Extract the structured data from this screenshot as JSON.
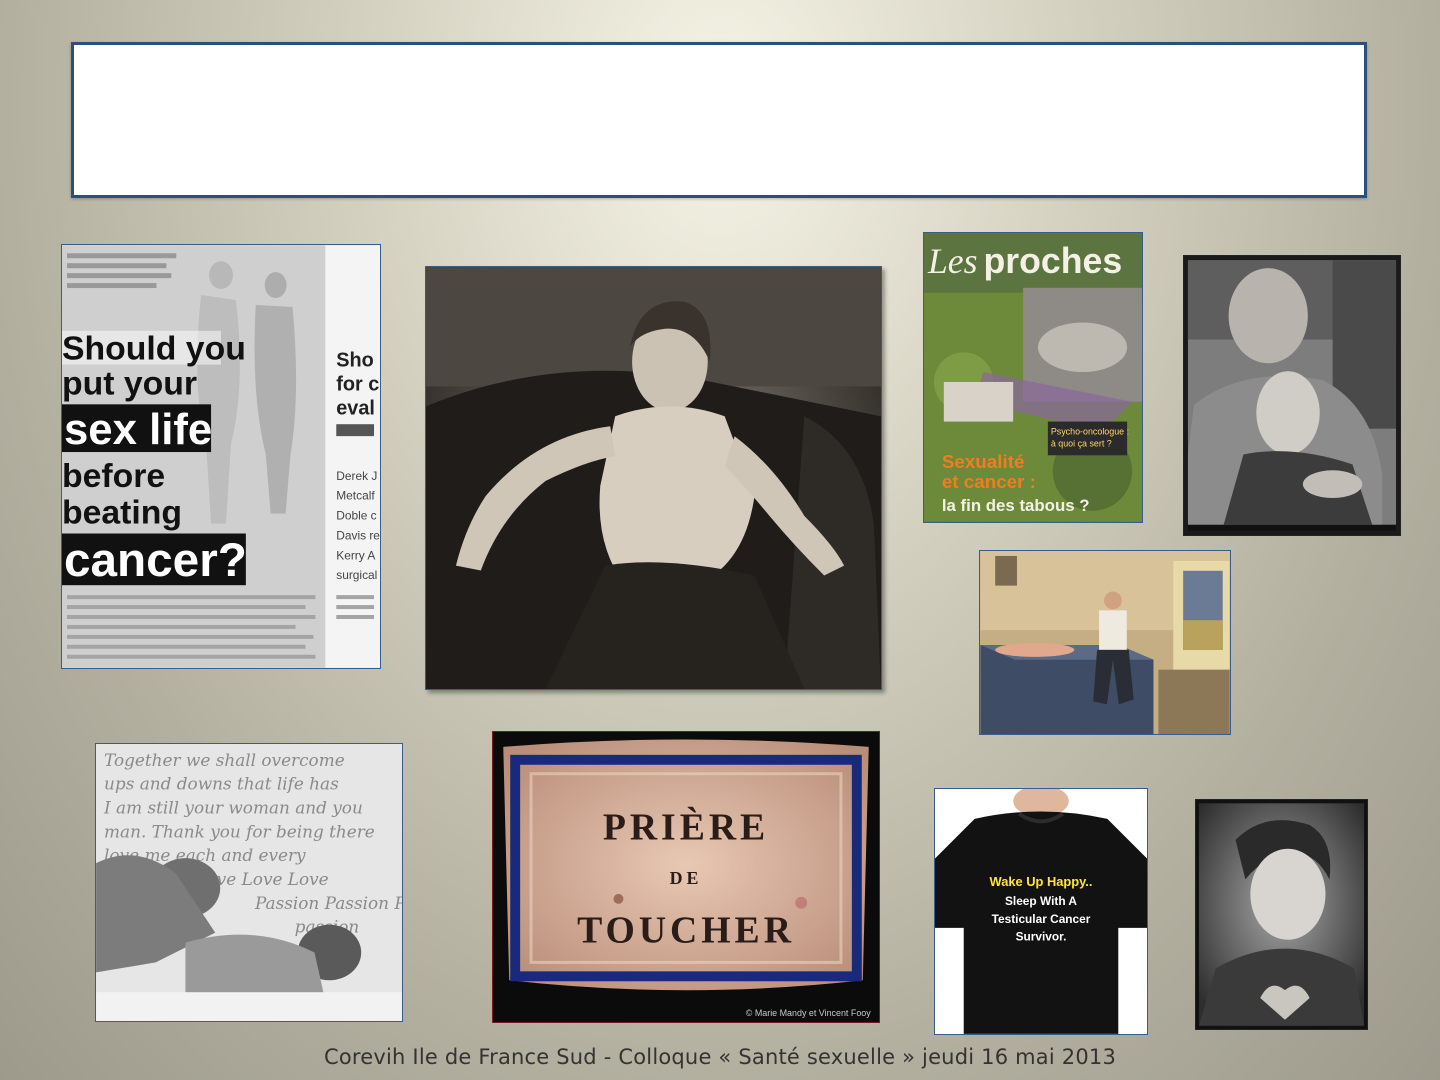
{
  "slide": {
    "footer": "Corevih Ile de France Sud - Colloque « Santé sexuelle » jeudi 16 mai 2013"
  },
  "images": {
    "newspaper": {
      "headline": [
        "Should you",
        "put your",
        "sex life",
        "before",
        "beating",
        "cancer?"
      ],
      "side_text": [
        "Sho",
        "for c",
        "eval"
      ],
      "names": [
        "Derek J",
        "Metcalf",
        "Doble c",
        "Davis re",
        "Kerry A",
        "surgical"
      ]
    },
    "magazine": {
      "title_les": "Les",
      "title_proches": "proches",
      "headline": [
        "Sexualité",
        "et cancer :",
        "la fin des tabous ?"
      ],
      "side_box": [
        "Psycho-oncologue :",
        "à quoi ça sert ?"
      ]
    },
    "priere": {
      "lines": [
        "PRIÈRE",
        "DE",
        "TOUCHER"
      ],
      "credit": "© Marie Mandy et Vincent Fooy"
    },
    "tshirt": {
      "lines": [
        "Wake Up Happy..",
        "Sleep With A",
        "Testicular Cancer",
        "Survivor."
      ]
    },
    "handwritten": {
      "lines": [
        "Together we shall overcome",
        "ups and downs that life has",
        "I am still your woman and you",
        "man. Thank you for being there",
        "love me each and every",
        "Love Love Love",
        "Passion Passion Pa",
        "passion"
      ]
    }
  }
}
